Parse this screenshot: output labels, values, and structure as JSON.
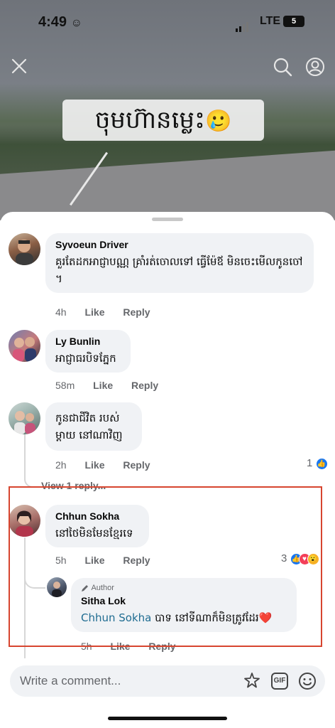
{
  "status_bar": {
    "time": "4:49",
    "time_emoji": "☺",
    "network": "LTE",
    "battery": "5"
  },
  "video": {
    "caption_text": "ចុមហ៊ានម្លេះ",
    "caption_emoji": "🥲",
    "close_icon": "close-icon",
    "search_icon": "search-icon",
    "profile_icon": "profile-icon"
  },
  "comments": [
    {
      "author": "Syvoeun Driver",
      "text": "គួរតែដកអាជ្ញាបណ្ណ គ្រាំរត់ចោលទៅ ធ្វើម៉ែឪ មិនចេះមើលកូនចៅ ។",
      "time": "4h",
      "like": "Like",
      "reply": "Reply"
    },
    {
      "author": "Ly Bunlin",
      "text": "អាជ្ញាធរបិទភ្នែក",
      "time": "58m",
      "like": "Like",
      "reply": "Reply"
    },
    {
      "author": "",
      "text": "កូនជាជីវិត របស់ម្តាយ នៅណាវិញ",
      "time": "2h",
      "like": "Like",
      "reply": "Reply",
      "reaction_count": "1",
      "view_replies": "View 1 reply..."
    },
    {
      "author": "Chhun Sokha",
      "text": "នៅថៃមិនមែនខ្មែរទេ",
      "time": "5h",
      "like": "Like",
      "reply": "Reply",
      "reaction_count": "3"
    }
  ],
  "reply": {
    "badge": "Author",
    "author": "Sitha Lok",
    "mention": "Chhun Sokha",
    "text": " បាទ នៅទីណាក៏មិនត្រូវដែរ",
    "heart": "❤️",
    "time": "5h",
    "like": "Like",
    "reply": "Reply"
  },
  "composer": {
    "placeholder": "Write a comment...",
    "sticker_icon": "sticker-icon",
    "gif_label": "GIF",
    "emoji_icon": "emoji-icon"
  },
  "colors": {
    "bubble": "#f0f2f5",
    "meta": "#65676b",
    "highlight": "#d7452f",
    "like_blue": "#1877f2",
    "love_red": "#f33e58",
    "mention": "#1f6c91"
  }
}
